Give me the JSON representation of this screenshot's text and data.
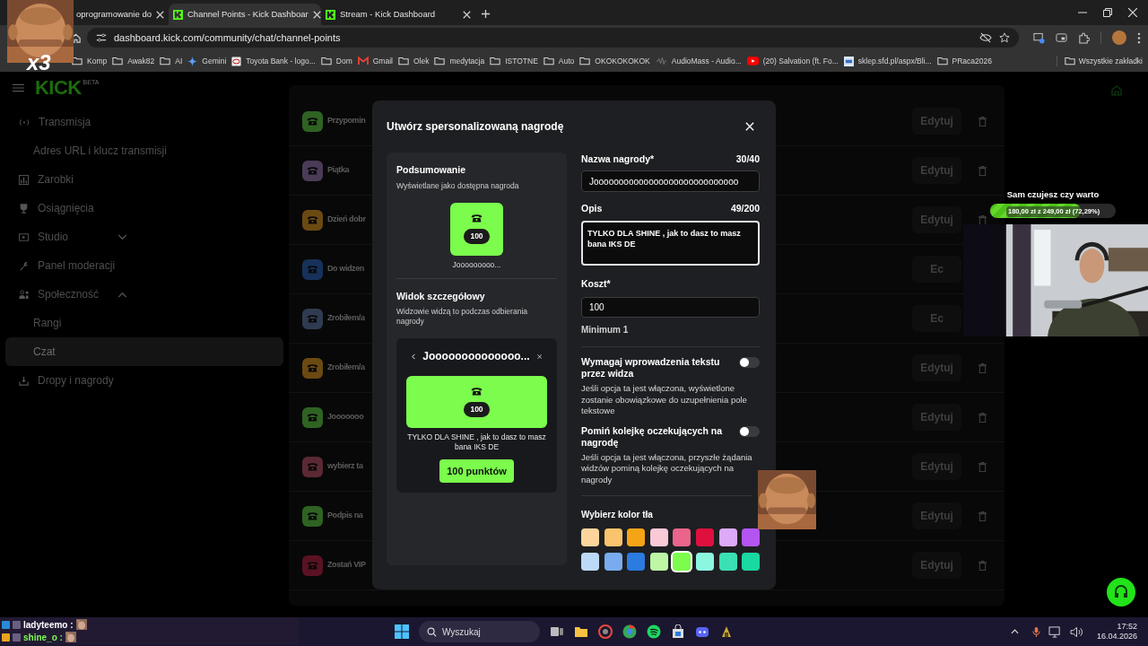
{
  "browser": {
    "tabs": [
      {
        "label": "oprogramowanie do",
        "selected": false
      },
      {
        "label": "Channel Points - Kick Dashboar",
        "selected": true
      },
      {
        "label": "Stream - Kick Dashboard",
        "selected": false
      }
    ],
    "url": "dashboard.kick.com/community/chat/channel-points",
    "bookmarks": [
      {
        "kind": "folder",
        "label": "Komp"
      },
      {
        "kind": "folder",
        "label": "Awak82"
      },
      {
        "kind": "folder",
        "label": "AI"
      },
      {
        "kind": "site",
        "label": "Gemini"
      },
      {
        "kind": "site",
        "label": "Toyota Bank - logo..."
      },
      {
        "kind": "folder",
        "label": "Dom"
      },
      {
        "kind": "site",
        "label": "Gmail"
      },
      {
        "kind": "folder",
        "label": "Olek"
      },
      {
        "kind": "folder",
        "label": "medytacja"
      },
      {
        "kind": "folder",
        "label": "ISTOTNE"
      },
      {
        "kind": "folder",
        "label": "Auto"
      },
      {
        "kind": "folder",
        "label": "OKOKOKOKOK"
      },
      {
        "kind": "site",
        "label": "AudioMass - Audio..."
      },
      {
        "kind": "site",
        "label": "(20) Salvation (ft. Fo..."
      },
      {
        "kind": "site",
        "label": "sklep.sfd.pl/aspx/Bli..."
      },
      {
        "kind": "folder",
        "label": "PRaca2026"
      }
    ],
    "all_bookmarks": "Wszystkie zakładki"
  },
  "emote_overlay": {
    "count": "x3"
  },
  "page": {
    "logo": "KICK",
    "logo_badge": "BETA",
    "sidebar": [
      {
        "label": "Transmisja",
        "selected": false,
        "children": [
          {
            "label": "Adres URL i klucz transmisji",
            "selected": false
          }
        ]
      },
      {
        "label": "Zarobki",
        "selected": false
      },
      {
        "label": "Osiągnięcia",
        "selected": false
      },
      {
        "label": "Studio",
        "selected": false,
        "expanded": false
      },
      {
        "label": "Panel moderacji",
        "selected": false
      },
      {
        "label": "Społeczność",
        "selected": false,
        "expanded": true,
        "children": [
          {
            "label": "Rangi",
            "selected": false
          },
          {
            "label": "Czat",
            "selected": true
          }
        ]
      },
      {
        "label": "Dropy i nagrody",
        "selected": false
      }
    ],
    "rewards": [
      {
        "name": "Przypomin",
        "color": "#2f6322",
        "edit": "Edytuj",
        "delete": true
      },
      {
        "name": "Piątka",
        "color": "#4b3b57",
        "edit": "Edytuj",
        "delete": true
      },
      {
        "name": "Dzień dobr",
        "color": "#6b4a12",
        "edit": "Edytuj",
        "delete": true
      },
      {
        "name": "Do widzen",
        "color": "#17325a",
        "edit": "Ec",
        "delete": false
      },
      {
        "name": "Zrobiłem/a",
        "color": "#2f3b50",
        "edit": "Ec",
        "delete": false
      },
      {
        "name": "Zrobiłem/a",
        "color": "#6b4a12",
        "edit": "Edytuj",
        "delete": true
      },
      {
        "name": "Jooooooo",
        "color": "#2f6322",
        "edit": "Edytuj",
        "delete": true
      },
      {
        "name": "wybierz ta",
        "color": "#5a2934",
        "edit": "Edytuj",
        "delete": true
      },
      {
        "name": "Podpis na",
        "color": "#2f6322",
        "edit": "Edytuj",
        "delete": true
      },
      {
        "name": "Zostań VIP",
        "color": "#5a1222",
        "edit": "Edytuj",
        "delete": true
      }
    ]
  },
  "modal": {
    "title": "Utwórz spersonalizowaną nagrodę",
    "summary": {
      "heading": "Podsumowanie",
      "subheading": "Wyświetlane jako dostępna nagroda",
      "cost": "100",
      "name": "Jooooooooo..."
    },
    "detail": {
      "heading": "Widok szczegółowy",
      "subheading": "Widzowie widzą to podczas odbierania nagrody",
      "title": "Joooooooooooooo...",
      "cost": "100",
      "description": "TYLKO DLA SHINE , jak to dasz to masz bana IKS DE",
      "button": "100 punktów"
    },
    "name_field": {
      "label": "Nazwa nagrody*",
      "counter": "30/40",
      "value": "Jooooooooooooooooooooooooooooo"
    },
    "description_field": {
      "label": "Opis",
      "counter": "49/200",
      "value": "TYLKO DLA SHINE , jak to dasz to masz bana IKS DE"
    },
    "cost_field": {
      "label": "Koszt*",
      "value": "100",
      "hint": "Minimum 1"
    },
    "toggles": [
      {
        "label": "Wymagaj wprowadzenia tekstu przez widza",
        "description": "Jeśli opcja ta jest włączona, wyświetlone zostanie obowiązkowe do uzupełnienia pole tekstowe",
        "on": false
      },
      {
        "label": "Pomiń kolejkę oczekujących na nagrodę",
        "description": "Jeśli opcja ta jest włączona, przyszłe żądania widzów pominą kolejkę oczekujących na nagrody",
        "on": false
      }
    ],
    "color_picker": {
      "label": "Wybierz kolor tła",
      "swatches": [
        {
          "color": "#fcd59c",
          "selected": false
        },
        {
          "color": "#f9c46c",
          "selected": false
        },
        {
          "color": "#f5a416",
          "selected": false
        },
        {
          "color": "#f9c9d6",
          "selected": false
        },
        {
          "color": "#ea648c",
          "selected": false
        },
        {
          "color": "#e0103e",
          "selected": false
        },
        {
          "color": "#dcaaf8",
          "selected": false
        },
        {
          "color": "#b455f2",
          "selected": false
        },
        {
          "color": "#bcd9f7",
          "selected": false
        },
        {
          "color": "#78acef",
          "selected": false
        },
        {
          "color": "#2b7be0",
          "selected": false
        },
        {
          "color": "#bdf7a6",
          "selected": false
        },
        {
          "color": "#7cfc4c",
          "selected": true
        },
        {
          "color": "#8cf7e1",
          "selected": false
        },
        {
          "color": "#3ae0b4",
          "selected": false
        },
        {
          "color": "#19d8a2",
          "selected": false
        }
      ]
    }
  },
  "stream_goal": {
    "title": "Sam czujesz czy warto",
    "progress": "180,00 zł z 249,00 zł (72,29%)",
    "level": 0.7229
  },
  "chat": [
    {
      "user": "ladyteemo :",
      "color": "#ffffff"
    },
    {
      "user": "shine_o :",
      "color": "#7cfc4c"
    }
  ],
  "taskbar": {
    "search": "Wyszukaj",
    "time": "17:52",
    "date": "16.04.2026"
  }
}
